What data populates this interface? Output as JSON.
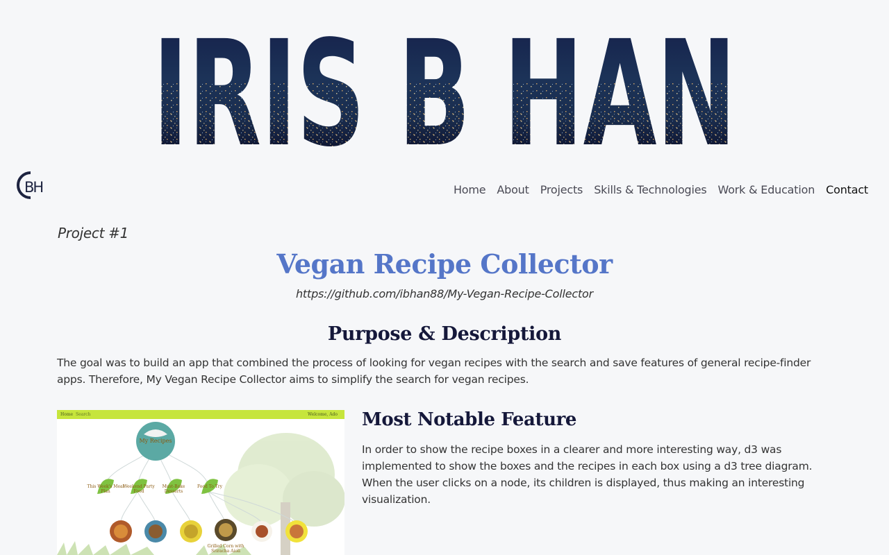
{
  "banner": {
    "name": "IRIS B HAN"
  },
  "logo": {
    "text": "BH",
    "icon": "bh-monogram-logo"
  },
  "nav": {
    "items": [
      {
        "label": "Home"
      },
      {
        "label": "About"
      },
      {
        "label": "Projects"
      },
      {
        "label": "Skills & Technologies"
      },
      {
        "label": "Work & Education"
      },
      {
        "label": "Contact"
      }
    ],
    "active": "Contact"
  },
  "project": {
    "number": "Project #1",
    "title": "Vegan Recipe Collector",
    "repo_url": "https://github.com/ibhan88/My-Vegan-Recipe-Collector",
    "purpose_heading": "Purpose & Description",
    "purpose_text": "The goal was to build an app that combined the process of looking for vegan recipes with the search and save features of general recipe-finder apps. Therefore, My Vegan Recipe Collector aims to simplify the search for vegan recipes.",
    "feature_heading": "Most Notable Feature",
    "feature_text": "In order to show the recipe boxes in a clearer and more interesting way, d3 was implemented to show the boxes and the recipes in each box using a d3 tree diagram. When the user clicks on a node, its children is displayed, thus making an interesting visualization."
  },
  "screenshot": {
    "bar_home": "Home",
    "bar_search": "Search",
    "bar_welcome": "Welcome, Ado",
    "root_label": "My Recipes",
    "branch_labels": [
      "This Week's Meal Plan",
      "Weekend Party Food",
      "Must-Bake Desserts",
      "Food To Try"
    ],
    "leaf_label": "Grilled Corn with Sriracha Aioli"
  },
  "colors": {
    "title_blue": "#5576c8",
    "heading_navy": "#15183a",
    "app_bar_green": "#c6e53c",
    "background": "#f6f7f9"
  }
}
